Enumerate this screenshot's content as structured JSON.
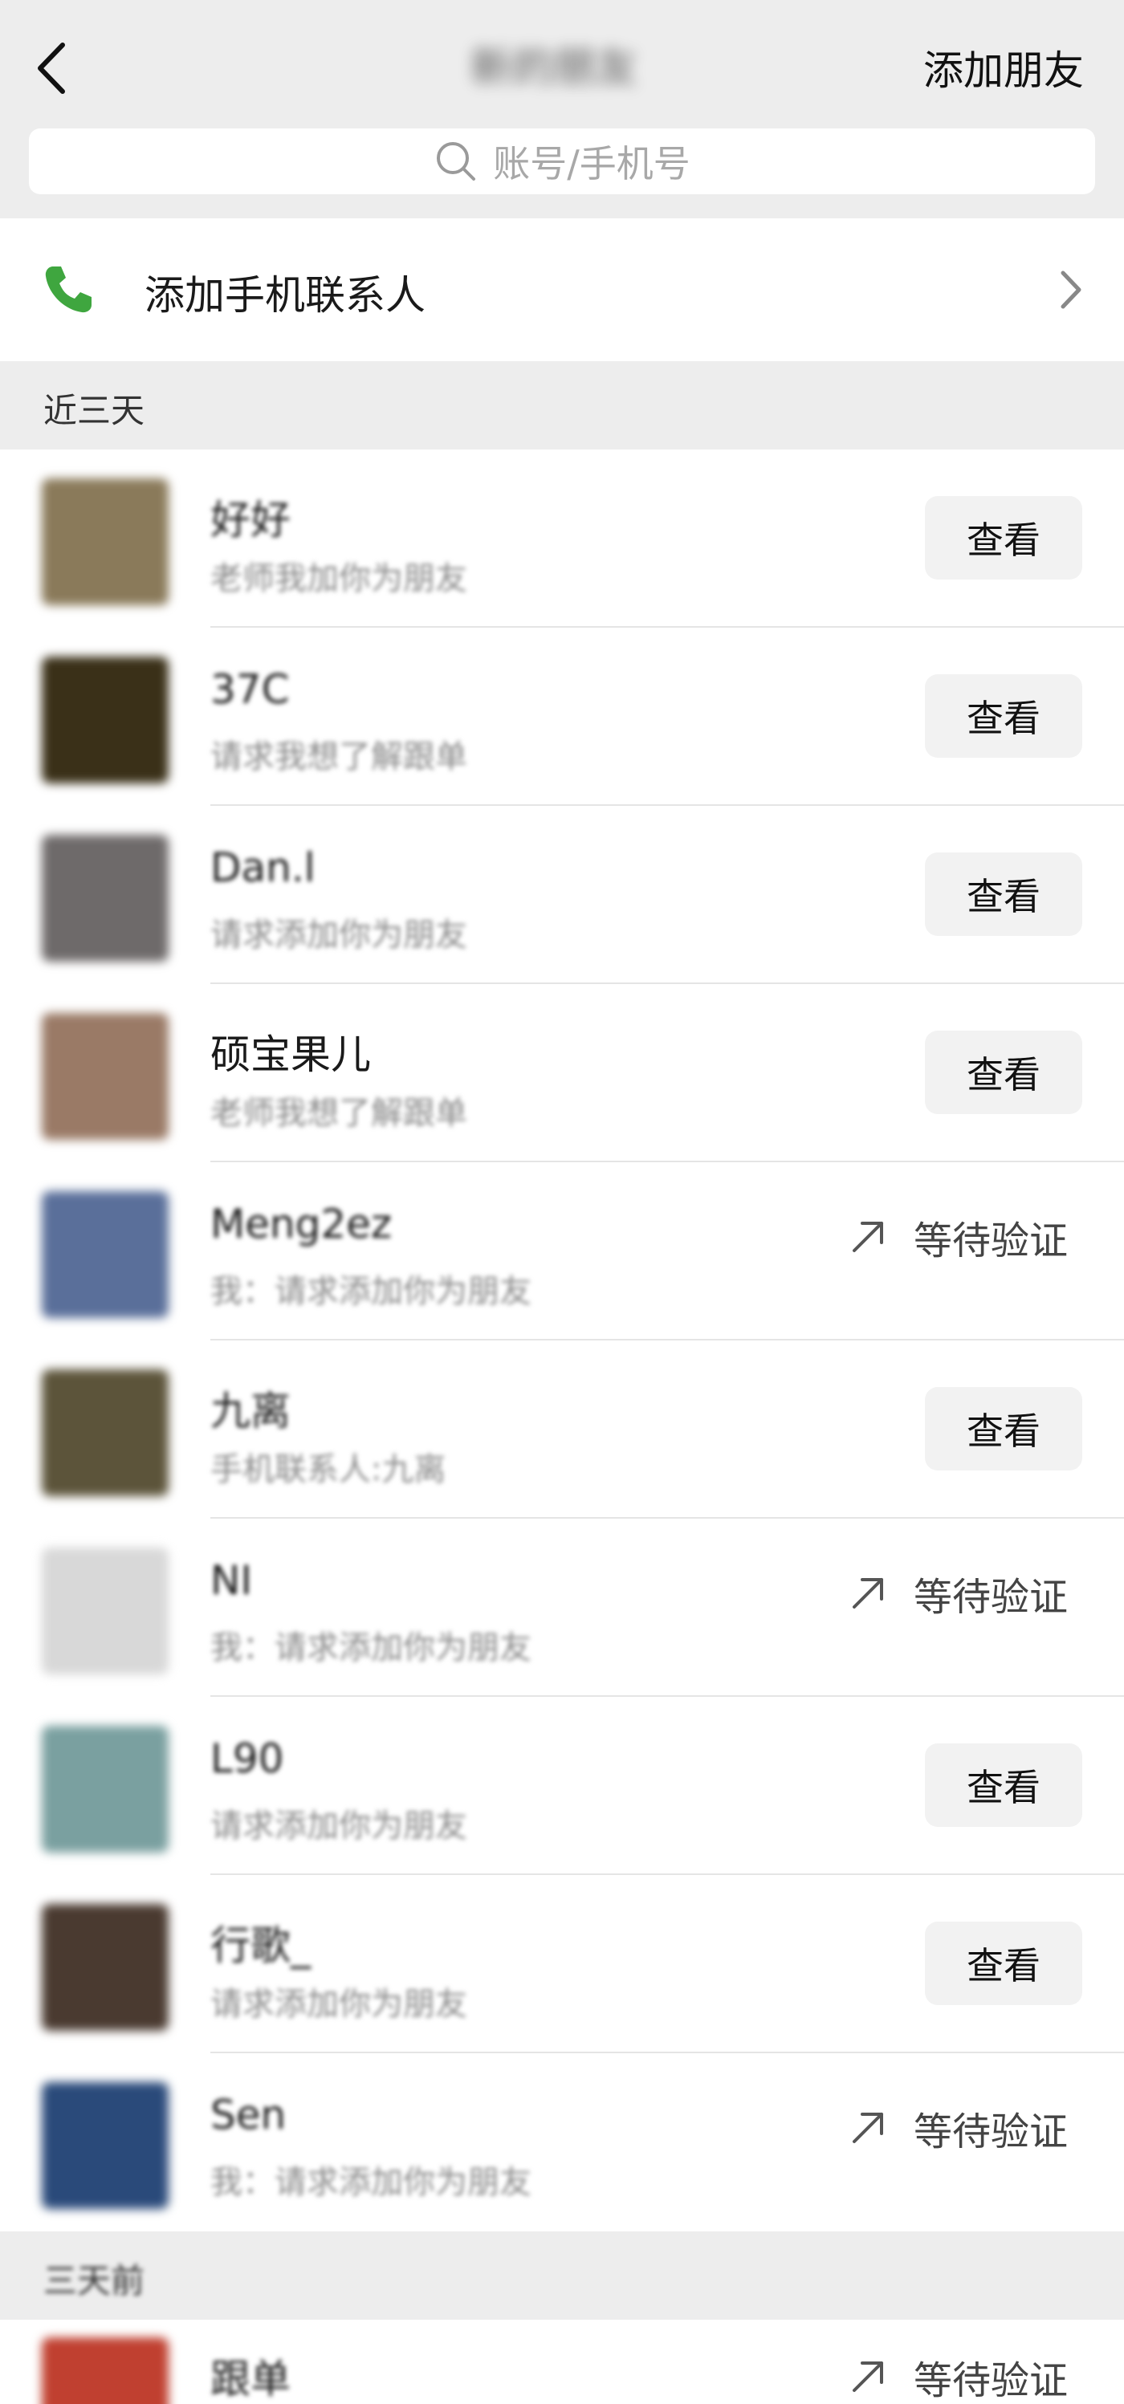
{
  "header": {
    "title": "新的朋友",
    "add_friend": "添加朋友",
    "back_icon": "chevron-left-icon"
  },
  "search": {
    "placeholder": "账号/手机号"
  },
  "phone_contacts": {
    "label": "添加手机联系人",
    "icon": "phone-icon"
  },
  "sections": {
    "recent": "近三天",
    "earlier": "三天前"
  },
  "actions": {
    "view": "查看",
    "pending": "等待验证"
  },
  "rows": [
    {
      "name": "好好",
      "message": "老师我加你为朋友",
      "status": "view",
      "color": "#8a7a5a"
    },
    {
      "name": "37C",
      "message": "请求我想了解跟单",
      "status": "view",
      "color": "#3a3018"
    },
    {
      "name": "Dan.l",
      "message": "请求添加你为朋友",
      "status": "view",
      "color": "#6e6a6a"
    },
    {
      "name": "硕宝果儿",
      "message": "老师我想了解跟单",
      "status": "view",
      "color": "#9a7a66"
    },
    {
      "name": "Meng2ez",
      "message": "我：请求添加你为朋友",
      "status": "pending",
      "color": "#5a6f9a"
    },
    {
      "name": "九离",
      "message": "手机联系人:九离",
      "status": "view",
      "color": "#5c543a"
    },
    {
      "name": "NI",
      "message": "我：请求添加你为朋友",
      "status": "pending",
      "color": "#d8d8d8"
    },
    {
      "name": "L90",
      "message": "请求添加你为朋友",
      "status": "view",
      "color": "#7aa0a0"
    },
    {
      "name": "行歌_",
      "message": "请求添加你为朋友",
      "status": "view",
      "color": "#4a3a30"
    },
    {
      "name": "Sen",
      "message": "我：请求添加你为朋友",
      "status": "pending",
      "color": "#2a4a7a"
    }
  ],
  "earlier_row": {
    "name": "跟单",
    "status": "pending",
    "color": "#c04030"
  }
}
